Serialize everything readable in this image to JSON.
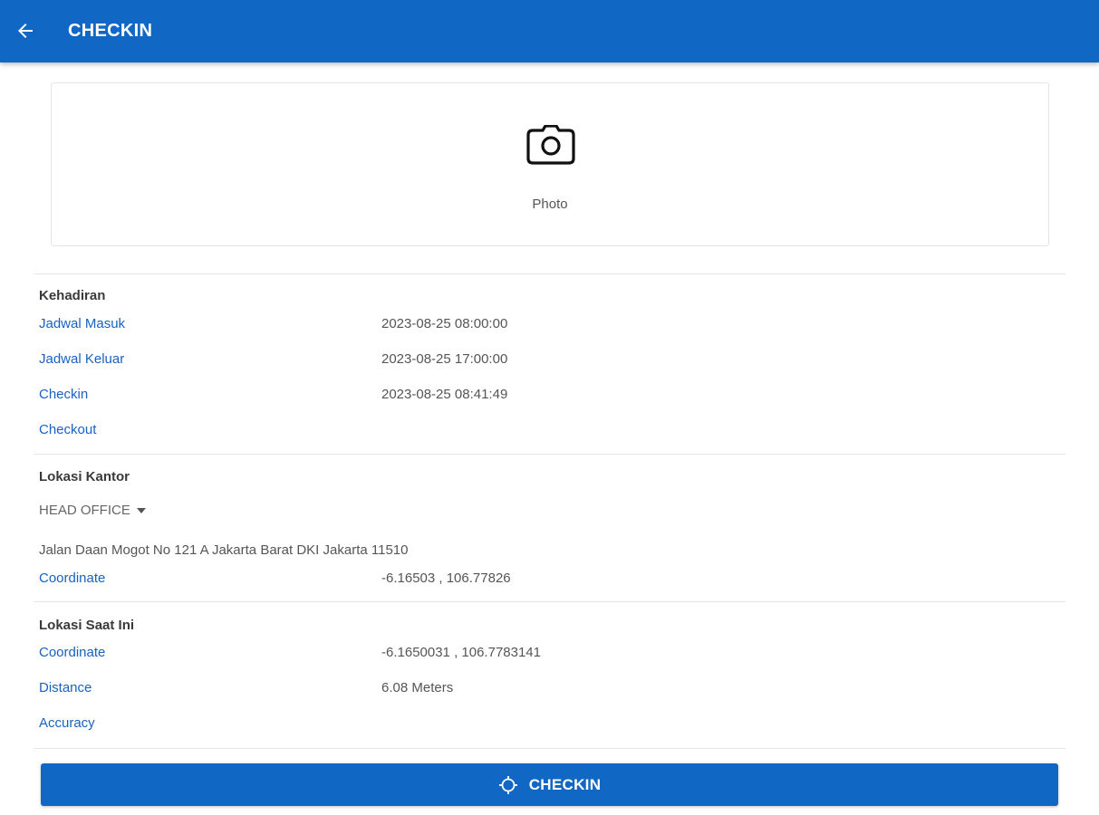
{
  "appbar": {
    "title": "CHECKIN",
    "back_icon": "arrow-left-icon"
  },
  "photo": {
    "icon": "camera-icon",
    "label": "Photo"
  },
  "attendance": {
    "title": "Kehadiran",
    "rows": [
      {
        "label": "Jadwal Masuk",
        "value": "2023-08-25 08:00:00"
      },
      {
        "label": "Jadwal Keluar",
        "value": "2023-08-25 17:00:00"
      },
      {
        "label": "Checkin",
        "value": "2023-08-25 08:41:49"
      },
      {
        "label": "Checkout",
        "value": ""
      }
    ]
  },
  "office": {
    "title": "Lokasi Kantor",
    "selected_office": "HEAD OFFICE",
    "address": "Jalan Daan Mogot No 121 A Jakarta Barat DKI Jakarta 11510",
    "coordinate_label": "Coordinate",
    "coordinate_value": "-6.16503 , 106.77826"
  },
  "current": {
    "title": "Lokasi Saat Ini",
    "rows": [
      {
        "label": "Coordinate",
        "value": "-6.1650031 , 106.7783141"
      },
      {
        "label": "Distance",
        "value": "6.08 Meters"
      },
      {
        "label": "Accuracy",
        "value": ""
      }
    ]
  },
  "action": {
    "label": "CHECKIN",
    "icon": "crosshair-icon"
  },
  "colors": {
    "primary": "#1167c4",
    "link": "#1a62c0"
  }
}
